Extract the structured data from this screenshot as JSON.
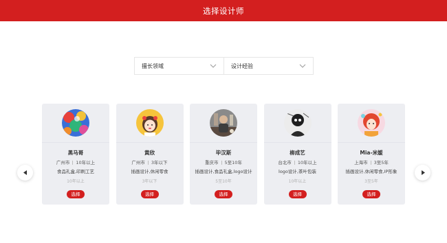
{
  "header": {
    "title": "选择设计师"
  },
  "filters": [
    {
      "label": "擅长领域",
      "icon": "chevron-down-icon"
    },
    {
      "label": "设计经验",
      "icon": "chevron-down-icon"
    }
  ],
  "nav": {
    "prev_icon": "chevron-left-icon",
    "next_icon": "chevron-right-icon"
  },
  "designers": [
    {
      "name": "黑马哥",
      "city": "广州市",
      "experience": "10年以上",
      "tags": "食品礼盒,印刷工艺",
      "experience_note": "10年以上",
      "select_label": "选择",
      "avatar": "colorful-illustration-avatar"
    },
    {
      "name": "黄欣",
      "city": "广州市",
      "experience": "3年以下",
      "tags": "插画设计,休闲零食",
      "experience_note": "3年以下",
      "select_label": "选择",
      "avatar": "cartoon-girl-avatar"
    },
    {
      "name": "毕汉斯",
      "city": "重庆市",
      "experience": "5至10年",
      "tags": "插画设计,食品礼盒,logo设计",
      "experience_note": "5至10年",
      "select_label": "选择",
      "avatar": "character-illustration-avatar"
    },
    {
      "name": "柳成艺",
      "city": "台北市",
      "experience": "10年以上",
      "tags": "logo设计,茶叶包装",
      "experience_note": "10年以上",
      "select_label": "选择",
      "avatar": "black-white-sketch-avatar"
    },
    {
      "name": "Mia-米媛",
      "city": "上海市",
      "experience": "3至5年",
      "tags": "插画设计,休闲零食,IP形象",
      "experience_note": "3至5年",
      "select_label": "选择",
      "avatar": "red-hair-character-avatar"
    }
  ],
  "colors": {
    "brand": "#d31f1f",
    "card_bg": "#edeef2"
  }
}
